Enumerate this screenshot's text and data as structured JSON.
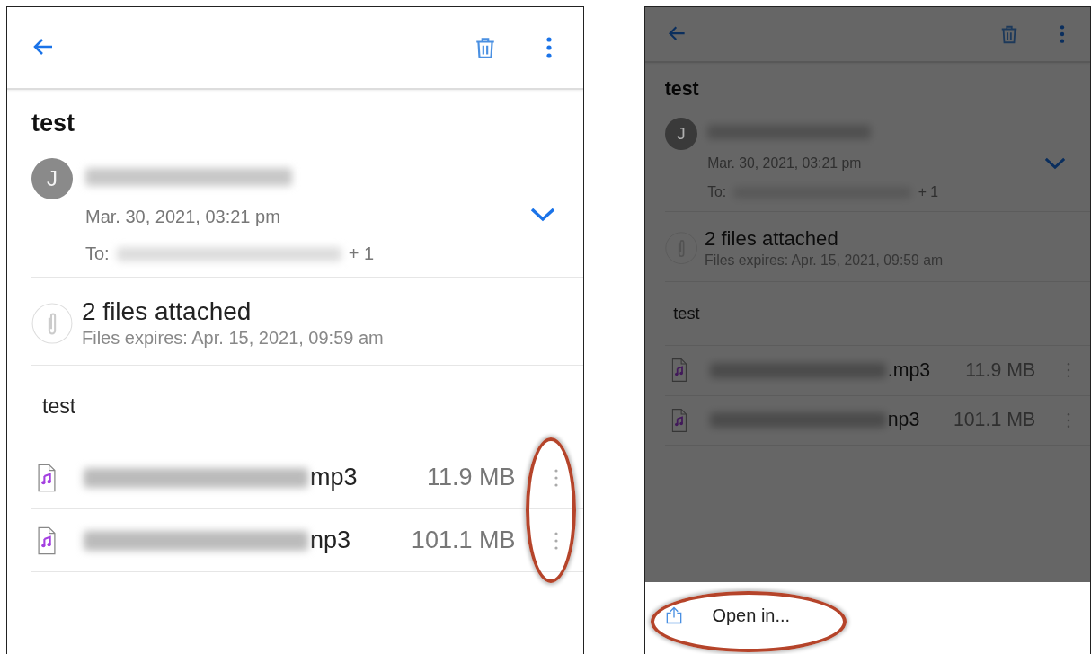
{
  "screens": [
    {
      "dimmed": false,
      "subject": "test",
      "avatar_letter": "J",
      "date": "Mar. 30, 2021, 03:21 pm",
      "to_label": "To:",
      "to_extra": "+ 1",
      "attachments_title": "2 files attached",
      "attachments_expiry": "Files expires: Apr. 15, 2021, 09:59 am",
      "body": "test",
      "files_callout": true,
      "files": [
        {
          "name_visible": "mp3",
          "size": "11.9 MB"
        },
        {
          "name_visible": "np3",
          "size": "101.1 MB"
        }
      ]
    },
    {
      "dimmed": true,
      "subject": "test",
      "avatar_letter": "J",
      "date": "Mar. 30, 2021, 03:21 pm",
      "to_label": "To:",
      "to_extra": "+ 1",
      "attachments_title": "2 files attached",
      "attachments_expiry": "Files expires: Apr. 15, 2021, 09:59 am",
      "body": "test",
      "files_callout": false,
      "files": [
        {
          "name_visible": ".mp3",
          "size": "11.9 MB"
        },
        {
          "name_visible": "np3",
          "size": "101.1 MB"
        }
      ],
      "sheet": {
        "items": [
          {
            "label": "Open in...",
            "callout": true
          }
        ]
      }
    }
  ]
}
